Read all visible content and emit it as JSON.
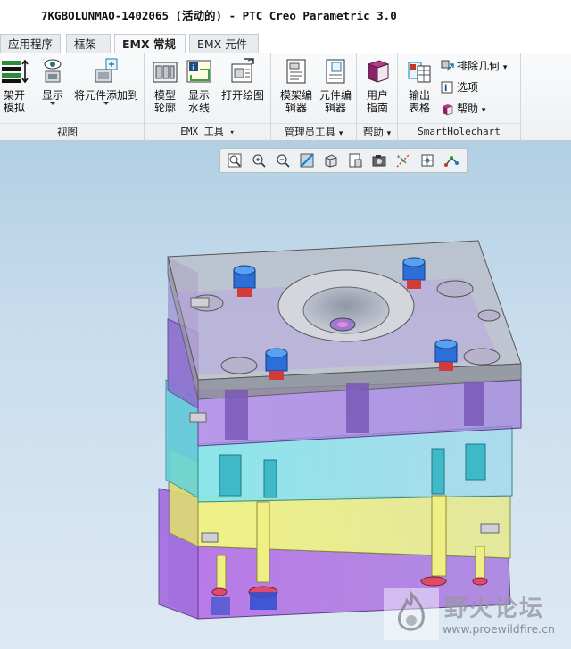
{
  "window": {
    "title": "7KGBOLUNMAO-1402065 (活动的) - PTC Creo Parametric 3.0"
  },
  "tabs": [
    {
      "label": "应用程序"
    },
    {
      "label": "框架"
    },
    {
      "label": "EMX 常规",
      "active": true
    },
    {
      "label": "EMX 元件"
    }
  ],
  "ribbon": {
    "groups": [
      {
        "label": "视图"
      },
      {
        "label": "EMX 工具"
      },
      {
        "label": "管理员工具"
      },
      {
        "label": "帮助"
      },
      {
        "label": "SmartHolechart"
      }
    ],
    "buttons": {
      "frame_open_line1": "架开",
      "frame_open_line2": "模拟",
      "display": "显示",
      "add_component": "将元件添加到",
      "mold_profile_line1": "模型",
      "mold_profile_line2": "轮廓",
      "waterline_line1": "显示",
      "waterline_line2": "水线",
      "open_drawing": "打开绘图",
      "frame_editor_line1": "模架编",
      "frame_editor_line2": "辑器",
      "component_editor_line1": "元件编",
      "component_editor_line2": "辑器",
      "user_guide_line1": "用户",
      "user_guide_line2": "指南",
      "export_table_line1": "输出",
      "export_table_line2": "表格"
    },
    "small_items": {
      "exclude_geometry": "排除几何",
      "options": "选项",
      "help": "帮助"
    }
  },
  "view_toolbar": {
    "icons": [
      "refit-icon",
      "zoom-in-icon",
      "zoom-out-icon",
      "repaint-icon",
      "display-style-icon",
      "saved-views-icon",
      "named-view-icon",
      "datum-display-icon",
      "spin-center-icon",
      "annotation-icon"
    ]
  },
  "watermark": {
    "text": "野火论坛",
    "url": "www.proewildfire.cn"
  },
  "colors": {
    "clamp_plate": "#a9a9ae",
    "cavity_plate": "#b99ee8",
    "core_plate": "#8ae0e6",
    "support_plate": "#e8ec7a",
    "ejector_plate": "#b57fe8",
    "pins": "#2d6fd8"
  }
}
